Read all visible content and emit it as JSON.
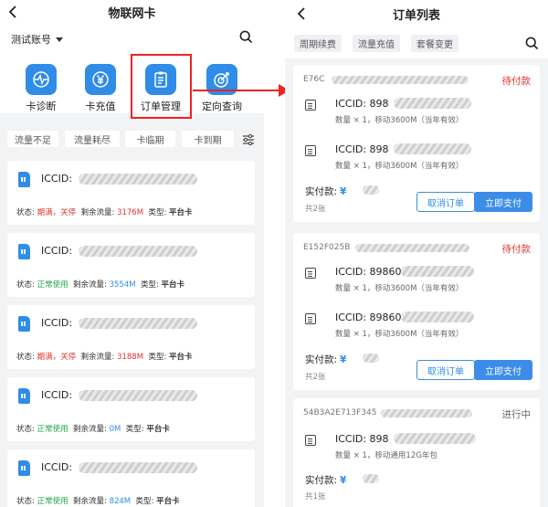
{
  "left": {
    "title": "物联网卡",
    "account": "测试账号",
    "functions": [
      {
        "label": "卡诊断"
      },
      {
        "label": "卡充值"
      },
      {
        "label": "订单管理"
      },
      {
        "label": "定向查询"
      }
    ],
    "filters": [
      "流量不足",
      "流量耗尽",
      "卡临期",
      "卡到期"
    ],
    "cards": [
      {
        "iccid_label": "ICCID:",
        "status_label": "状态:",
        "status": "期满，关停",
        "remain_label": "剩余流量:",
        "remain": "3176M",
        "type_label": "类型:",
        "type": "平台卡"
      },
      {
        "iccid_label": "ICCID:",
        "status_label": "状态:",
        "status": "正常使用",
        "remain_label": "剩余流量:",
        "remain": "3554M",
        "type_label": "类型:",
        "type": "平台卡"
      },
      {
        "iccid_label": "ICCID:",
        "status_label": "状态:",
        "status": "期满，关停",
        "remain_label": "剩余流量:",
        "remain": "3188M",
        "type_label": "类型:",
        "type": "平台卡"
      },
      {
        "iccid_label": "ICCID:",
        "status_label": "状态:",
        "status": "正常使用",
        "remain_label": "剩余流量:",
        "remain": "0M",
        "type_label": "类型:",
        "type": "平台卡"
      },
      {
        "iccid_label": "ICCID:",
        "status_label": "状态:",
        "status": "正常使用",
        "remain_label": "剩余流量:",
        "remain": "824M",
        "type_label": "类型:",
        "type": "平台卡"
      }
    ]
  },
  "right": {
    "title": "订单列表",
    "tabs": [
      "周期续费",
      "流量充值",
      "套餐变更"
    ],
    "orders": [
      {
        "order_no": "E76C",
        "status": "待付款",
        "items": [
          {
            "iccid": "ICCID: 898",
            "desc": "数量 × 1，移动3600M（当年有效）"
          },
          {
            "iccid": "ICCID: 898",
            "desc": "数量 × 1，移动3600M（当年有效）"
          }
        ],
        "pay_label": "实付款:",
        "currency": "¥",
        "count": "共2张",
        "cancel": "取消订单",
        "pay": "立即支付"
      },
      {
        "order_no": "E152F025B",
        "status": "待付款",
        "items": [
          {
            "iccid": "ICCID: 89860",
            "desc": "数量 × 1，移动3600M（当年有效）"
          },
          {
            "iccid": "ICCID: 89860",
            "desc": "数量 × 1，移动3600M（当年有效）"
          }
        ],
        "pay_label": "实付款:",
        "currency": "¥",
        "count": "共2张",
        "cancel": "取消订单",
        "pay": "立即支付"
      },
      {
        "order_no": "54B3A2E713F345",
        "status": "进行中",
        "items": [
          {
            "iccid": "ICCID: 898",
            "desc": "数量 × 1，移动通用12G年包"
          }
        ],
        "pay_label": "实付款:",
        "currency": "¥",
        "count": "共1张"
      }
    ]
  },
  "colors": {
    "accent": "#2f8ce8",
    "danger": "#e0332f",
    "success": "#20a546",
    "highlight": "#ee2222"
  }
}
